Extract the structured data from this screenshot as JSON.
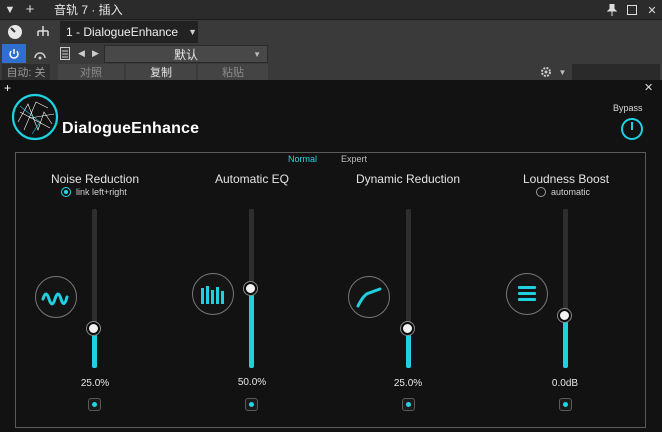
{
  "host": {
    "title": "音轨 7 · 插入",
    "tab_label": "1 - DialogueEnhance",
    "preset_name": "默认",
    "auto_label": "自动: 关",
    "compare_label": "对照",
    "copy_label": "复制",
    "paste_label": "粘贴"
  },
  "plugin": {
    "name": "DialogueEnhance",
    "bypass_label": "Bypass",
    "mode_normal": "Normal",
    "mode_expert": "Expert"
  },
  "modules": [
    {
      "title": "Noise Reduction",
      "option": "link left+right",
      "option_on": true,
      "value": "25.0%",
      "level": 0.25,
      "icon": "waveform-icon"
    },
    {
      "title": "Automatic EQ",
      "option": "",
      "option_on": false,
      "value": "50.0%",
      "level": 0.5,
      "icon": "eq-bars-icon"
    },
    {
      "title": "Dynamic Reduction",
      "option": "",
      "option_on": false,
      "value": "25.0%",
      "level": 0.25,
      "icon": "compressor-curve-icon"
    },
    {
      "title": "Loudness Boost",
      "option": "automatic",
      "option_on": false,
      "value": "0.0dB",
      "level": 0.33,
      "icon": "loudness-icon"
    }
  ],
  "colors": {
    "accent": "#1fd0e0",
    "background": "#121212"
  }
}
